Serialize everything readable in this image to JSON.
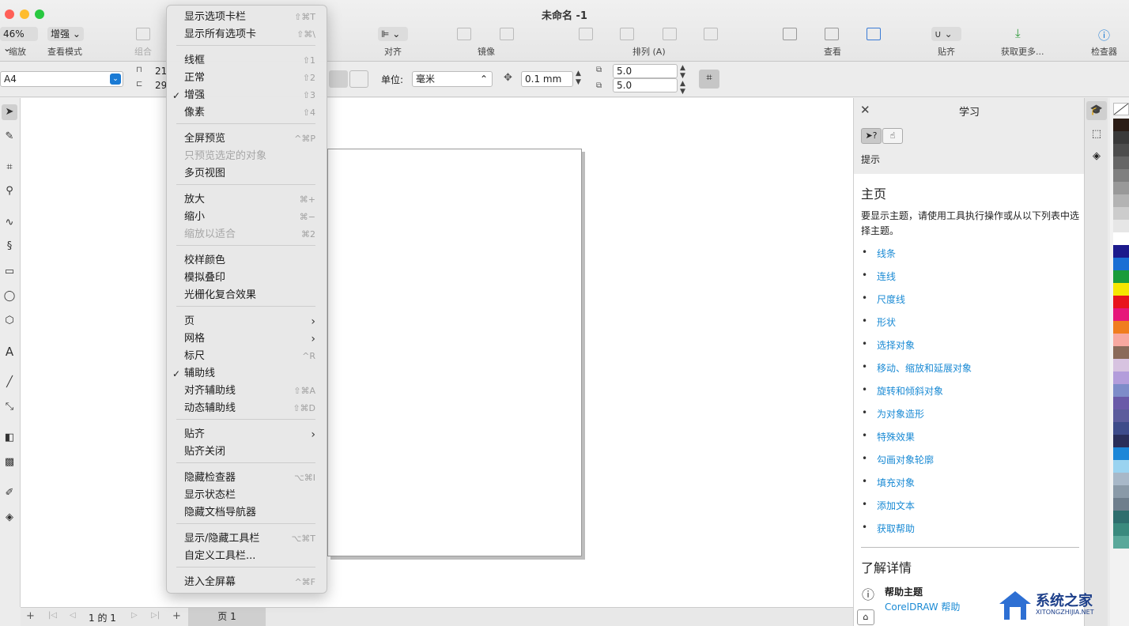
{
  "window": {
    "title": "未命名 -1"
  },
  "toolbar": {
    "zoom": "46%",
    "view_mode": "增强",
    "labels": {
      "zoom": "缩放",
      "view_mode": "查看模式",
      "group": "组合",
      "align": "对齐",
      "mirror": "镜像",
      "arrange": "排列 (A)",
      "view": "查看",
      "snap": "贴齐",
      "get_more": "获取更多...",
      "inspector": "检查器"
    }
  },
  "propbar": {
    "paper": "A4",
    "width_val": "21",
    "height_val": "29",
    "unit_label": "单位:",
    "unit": "毫米",
    "nudge": "0.1 mm",
    "dup_x": "5.0",
    "dup_y": "5.0"
  },
  "bottom": {
    "page_info": "1 的 1",
    "page_tab": "页 1"
  },
  "menu": {
    "items": [
      {
        "label": "显示选项卡栏",
        "shortcut": "⇧⌘T"
      },
      {
        "label": "显示所有选项卡",
        "shortcut": "⇧⌘\\"
      },
      {
        "label": "线框",
        "shortcut": "⇧1"
      },
      {
        "label": "正常",
        "shortcut": "⇧2"
      },
      {
        "label": "增强",
        "shortcut": "⇧3",
        "checked": "✓"
      },
      {
        "label": "像素",
        "shortcut": "⇧4"
      },
      {
        "label": "全屏预览",
        "shortcut": "^⌘P"
      },
      {
        "label": "只预览选定的对象",
        "shortcut": ""
      },
      {
        "label": "多页视图",
        "shortcut": ""
      },
      {
        "label": "放大",
        "shortcut": "⌘+"
      },
      {
        "label": "缩小",
        "shortcut": "⌘−"
      },
      {
        "label": "缩放以适合",
        "shortcut": "⌘2"
      },
      {
        "label": "校样颜色",
        "shortcut": ""
      },
      {
        "label": "模拟叠印",
        "shortcut": ""
      },
      {
        "label": "光栅化复合效果",
        "shortcut": ""
      },
      {
        "label": "页",
        "shortcut": ""
      },
      {
        "label": "网格",
        "shortcut": ""
      },
      {
        "label": "标尺",
        "shortcut": "^R"
      },
      {
        "label": "辅助线",
        "shortcut": "",
        "checked": "✓"
      },
      {
        "label": "对齐辅助线",
        "shortcut": "⇧⌘A"
      },
      {
        "label": "动态辅助线",
        "shortcut": "⇧⌘D"
      },
      {
        "label": "贴齐",
        "shortcut": ""
      },
      {
        "label": "贴齐关闭",
        "shortcut": ""
      },
      {
        "label": "隐藏检查器",
        "shortcut": "⌥⌘I"
      },
      {
        "label": "显示状态栏",
        "shortcut": ""
      },
      {
        "label": "隐藏文档导航器",
        "shortcut": ""
      },
      {
        "label": "显示/隐藏工具栏",
        "shortcut": "⌥⌘T"
      },
      {
        "label": "自定义工具栏...",
        "shortcut": ""
      },
      {
        "label": "进入全屏幕",
        "shortcut": "^⌘F"
      }
    ]
  },
  "learn": {
    "title": "学习",
    "tips": "提示",
    "home": "主页",
    "intro": "要显示主题，请使用工具执行操作或从以下列表中选择主题。",
    "links": [
      "线条",
      "连线",
      "尺度线",
      "形状",
      "选择对象",
      "移动、缩放和延展对象",
      "旋转和倾斜对象",
      "为对象造形",
      "特殊效果",
      "勾画对象轮廓",
      "填充对象",
      "添加文本",
      "获取帮助"
    ],
    "more": "了解详情",
    "help_topic": "帮助主题",
    "help_link": "CorelDRAW 帮助"
  },
  "watermark": {
    "text": "系统之家",
    "sub": "XITONGZHIJIA.NET"
  },
  "palette": [
    "#2b1d16",
    "#3a3a3a",
    "#4d4d4d",
    "#666666",
    "#808080",
    "#999999",
    "#b3b3b3",
    "#cccccc",
    "#e6e6e6",
    "#ffffff",
    "#1c1a8c",
    "#1a6fd4",
    "#1a9c3a",
    "#f5e600",
    "#e8141c",
    "#e6177a",
    "#f07d1e",
    "#f7a8a0",
    "#8a6a5a",
    "#d7c3e0",
    "#b39ddb",
    "#7e8cc9",
    "#6a5aa8",
    "#5c5c9c",
    "#3e4c8a",
    "#2a2f5a",
    "#1d87d8",
    "#9ad3f0",
    "#a8b8c8",
    "#8a9aa8",
    "#6e7e8c",
    "#2e6e6e",
    "#3a8a7e",
    "#5aa89a"
  ]
}
